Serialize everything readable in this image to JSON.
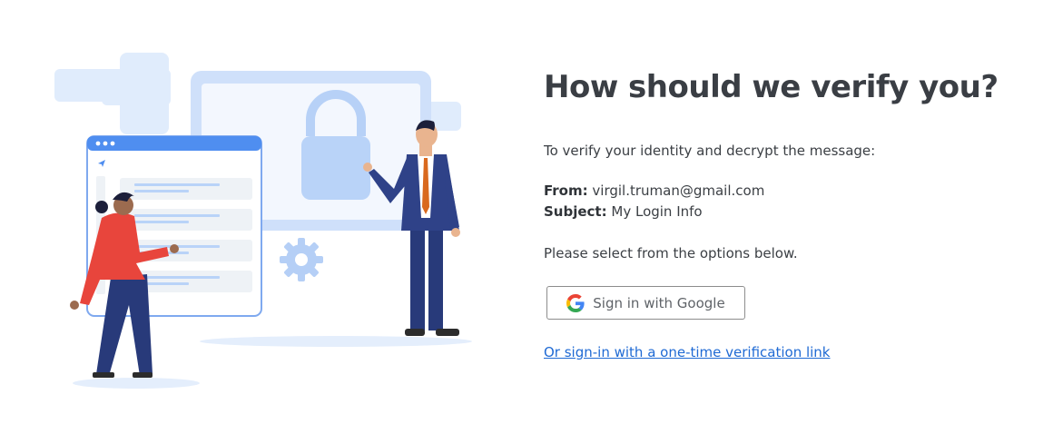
{
  "heading": "How should we verify you?",
  "intro": "To verify your identity and decrypt the message:",
  "message": {
    "from_label": "From:",
    "from_value": "virgil.truman@gmail.com",
    "subject_label": "Subject:",
    "subject_value": "My Login Info"
  },
  "instruction": "Please select from the options below.",
  "google_button": {
    "label": "Sign in with Google",
    "icon": "google-g-icon"
  },
  "one_time_link": "Or sign-in with a one-time verification link",
  "colors": {
    "link": "#1f6ad4",
    "illustration_light_blue": "#dbe9fb",
    "illustration_blue": "#4f8ef0",
    "suit_navy": "#283a7a",
    "accent_red": "#e8453c",
    "tie_orange": "#d9691f"
  }
}
